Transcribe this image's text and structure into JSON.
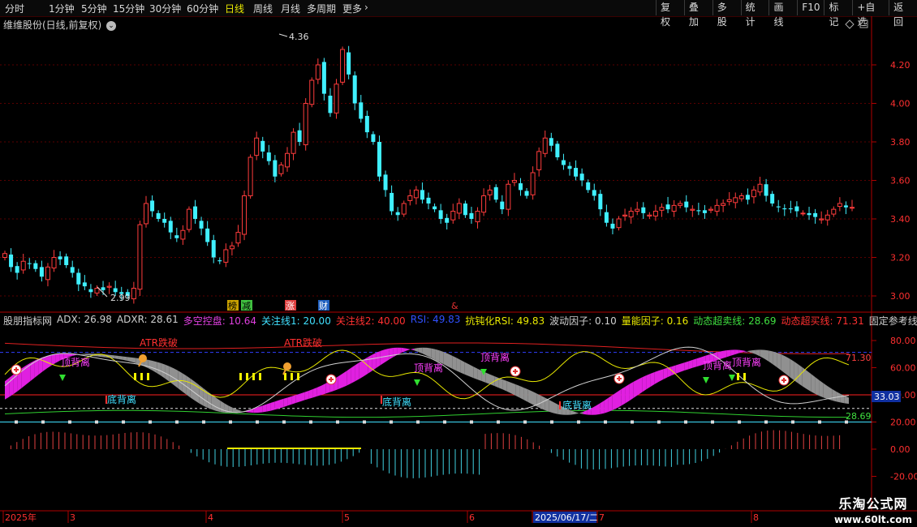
{
  "toolbar": {
    "periods": [
      "分时",
      "1分钟",
      "5分钟",
      "15分钟",
      "30分钟",
      "60分钟",
      "日线",
      "周线",
      "月线",
      "多周期",
      "更多"
    ],
    "active": "日线",
    "right_buttons": [
      "复权",
      "叠加",
      "多股",
      "统计",
      "画线",
      "F10",
      "标记",
      "+自选",
      "返回"
    ]
  },
  "stock": {
    "title": "维维股份(日线,前复权)"
  },
  "price_axis": [
    "4.20",
    "4.00",
    "3.80",
    "3.60",
    "3.40",
    "3.20",
    "3.00"
  ],
  "price_annot": {
    "high": "4.36",
    "low": "2.99"
  },
  "badges": [
    "榜",
    "减",
    "涨",
    "财",
    "&"
  ],
  "indicator_header": [
    {
      "text": "股朋指标网",
      "color": "#d0d0d0"
    },
    {
      "text": "ADX: 26.98",
      "color": "#d0d0d0"
    },
    {
      "text": "ADXR: 28.61",
      "color": "#d0d0d0"
    },
    {
      "text": "多空控盘: 10.64",
      "color": "#e040e0"
    },
    {
      "text": "关注线1: 20.00",
      "color": "#40e0ff"
    },
    {
      "text": "关注线2: 40.00",
      "color": "#ff3030"
    },
    {
      "text": "RSI: 49.83",
      "color": "#3050ff"
    },
    {
      "text": "抗钝化RSI: 49.83",
      "color": "#e8e800"
    },
    {
      "text": "波动因子: 0.10",
      "color": "#d0d0d0"
    },
    {
      "text": "量能因子: 0.16",
      "color": "#e8e800"
    },
    {
      "text": "动态超卖线: 28.69",
      "color": "#40e040"
    },
    {
      "text": "动态超买线: 71.31",
      "color": "#ff3030"
    },
    {
      "text": "固定参考线",
      "color": "#d0d0d0"
    }
  ],
  "ind_axis": [
    "80.00",
    "60.00",
    "40.00",
    "20.00",
    "0.00",
    "-20.00"
  ],
  "ind_values": {
    "overbought": "71.30",
    "current": "33.03",
    "oversold": "28.69"
  },
  "labels": {
    "top_div": "顶背离",
    "bottom_div": "底背离",
    "atr_break": "ATR跌破"
  },
  "dates": [
    "2025年",
    "3",
    "4",
    "5",
    "6",
    "2025/06/17/二",
    "7",
    "8"
  ],
  "watermark": {
    "line1": "乐淘公式网",
    "line2": "www.60lt.com"
  }
}
